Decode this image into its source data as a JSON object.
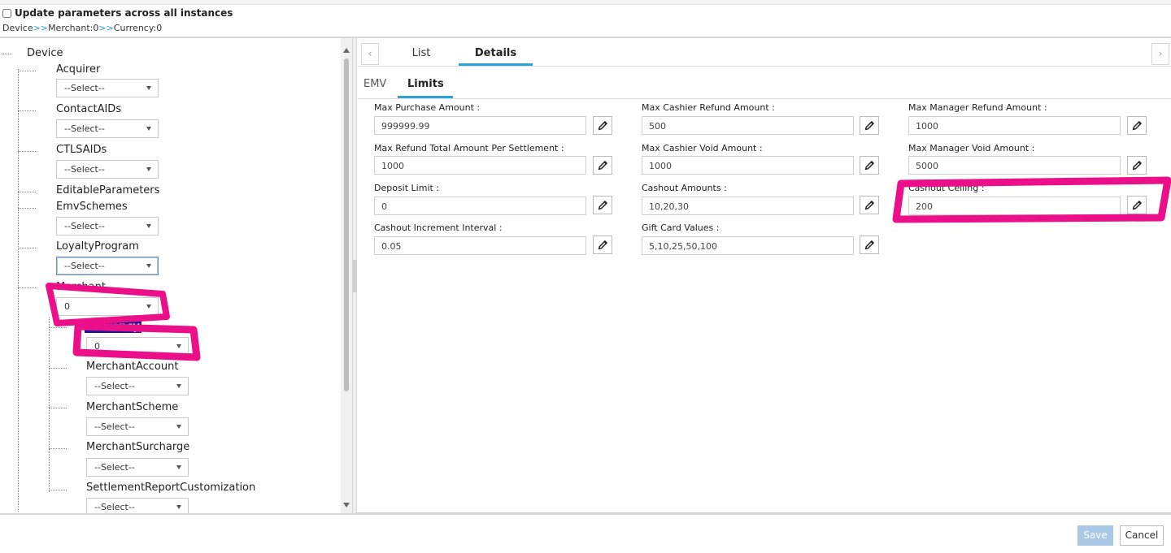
{
  "header": {
    "update_checkbox_label": "Update parameters across all instances",
    "update_checked": false,
    "breadcrumb": {
      "item1": "Device",
      "sep1": ">>",
      "item2": "Merchant:0",
      "sep2": ">>",
      "item3": "Currency:0"
    }
  },
  "tree": {
    "root": "Device",
    "nodes": [
      {
        "label": "Acquirer",
        "select": "--Select--"
      },
      {
        "label": "ContactAIDs",
        "select": "--Select--"
      },
      {
        "label": "CTLSAIDs",
        "select": "--Select--"
      },
      {
        "label": "EditableParameters"
      },
      {
        "label": "EmvSchemes",
        "select": "--Select--"
      },
      {
        "label": "LoyaltyProgram",
        "select": "--Select--"
      },
      {
        "label": "Merchant",
        "select": "0"
      }
    ],
    "merchant_children": [
      {
        "label": "Currency",
        "select": "0"
      },
      {
        "label": "MerchantAccount",
        "select": "--Select--"
      },
      {
        "label": "MerchantScheme",
        "select": "--Select--"
      },
      {
        "label": "MerchantSurcharge",
        "select": "--Select--"
      },
      {
        "label": "SettlementReportCustomization",
        "select": "--Select--"
      }
    ]
  },
  "tabs": {
    "prev": "‹",
    "next": "›",
    "items": [
      "List",
      "Details"
    ],
    "active": "Details"
  },
  "subtabs": {
    "items": [
      "EMV",
      "Limits"
    ],
    "active": "Limits"
  },
  "fields": [
    {
      "label": "Max Purchase Amount :",
      "value": "999999.99"
    },
    {
      "label": "Max Cashier Refund Amount :",
      "value": "500"
    },
    {
      "label": "Max Manager Refund Amount :",
      "value": "1000"
    },
    {
      "label": "Max Refund Total Amount Per Settlement :",
      "value": "1000"
    },
    {
      "label": "Max Cashier Void Amount :",
      "value": "1000"
    },
    {
      "label": "Max Manager Void Amount :",
      "value": "5000"
    },
    {
      "label": "Deposit Limit :",
      "value": "0"
    },
    {
      "label": "Cashout Amounts :",
      "value": "10,20,30"
    },
    {
      "label": "Cashout Ceiling :",
      "value": "200"
    },
    {
      "label": "Cashout Increment Interval :",
      "value": "0.05"
    },
    {
      "label": "Gift Card Values :",
      "value": "5,10,25,50,100"
    }
  ],
  "footer": {
    "save_label": "Save",
    "cancel_label": "Cancel"
  },
  "colors": {
    "accent": "#2ba3d9",
    "annotation": "#ec0f8a",
    "currency_highlight": "#1c1b8c",
    "save_disabled": "#a9c8e6"
  },
  "icons": [
    "pencil-icon",
    "chevron-left-icon",
    "chevron-right-icon",
    "dropdown-caret-icon"
  ]
}
